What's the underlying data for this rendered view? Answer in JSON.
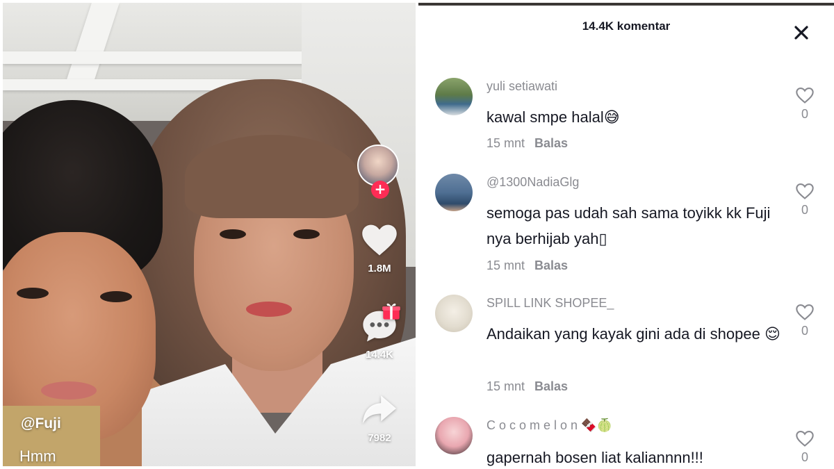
{
  "video": {
    "username": "@Fuji",
    "caption": "Hmm",
    "likes": "1.8M",
    "comments": "14.4K",
    "shares": "7982",
    "follow_icon": "plus-icon",
    "accent_color": "#fe2c55"
  },
  "comments_panel": {
    "title": "14.4K komentar",
    "close_icon": "close-icon",
    "reply_label": "Balas",
    "items": [
      {
        "user": "yuli setiawati",
        "text": "kawal smpe halal",
        "emoji": "😅",
        "time": "15 mnt",
        "likes": "0"
      },
      {
        "user": "@1300NadiaGlg",
        "text": "semoga pas udah sah sama toyikk kk Fuji nya berhijab yah",
        "emoji": "▯",
        "time": "15 mnt",
        "likes": "0"
      },
      {
        "user": "SPILL LINK SHOPEE_",
        "text": "Andaikan yang kayak gini ada di shopee",
        "emoji": "😌",
        "time": "15 mnt",
        "likes": "0"
      },
      {
        "user": "C o c o m e l o n",
        "user_emoji": "🍫🍈",
        "text": "gapernah bosen liat kaliannnn!!!",
        "time": "",
        "likes": "0"
      }
    ]
  }
}
